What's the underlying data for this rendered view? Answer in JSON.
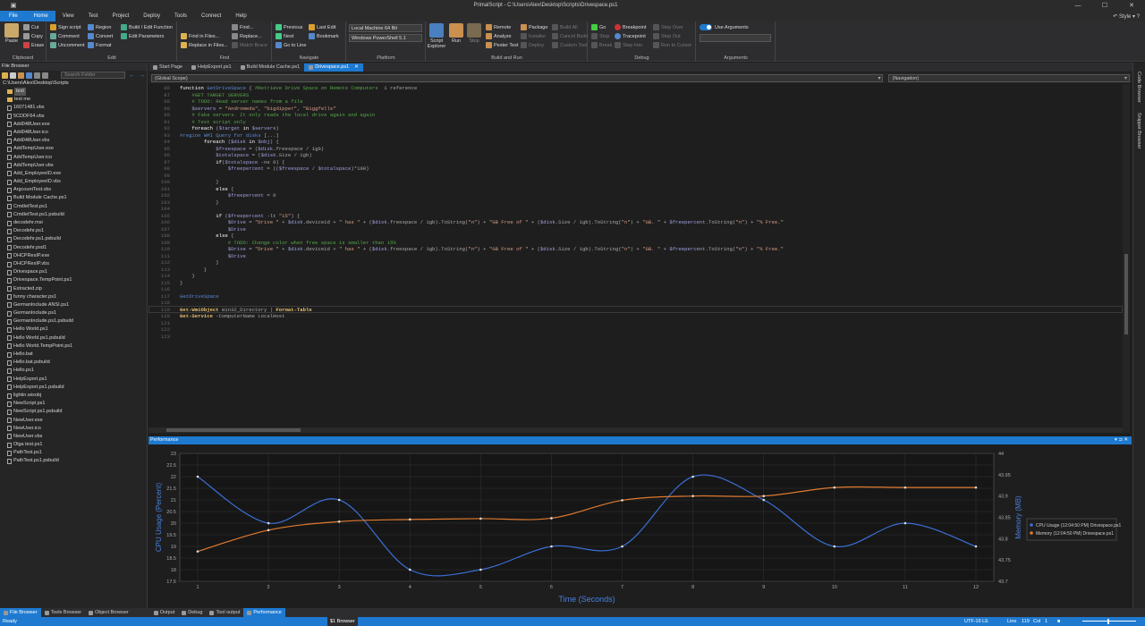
{
  "window": {
    "title": "PrimalScript - C:\\Users\\Alex\\Desktop\\Scripts\\Drivespace.ps1"
  },
  "menu": {
    "items": [
      "File",
      "Home",
      "View",
      "Test",
      "Project",
      "Deploy",
      "Tools",
      "Connect",
      "Help"
    ],
    "style": "Style"
  },
  "ribbon": {
    "clipboard": {
      "label": "Clipboard",
      "paste": "Paste",
      "cut": "Cut",
      "copy": "Copy",
      "erase": "Erase"
    },
    "edit": {
      "label": "Edit",
      "sign": "Sign script",
      "comment": "Comment",
      "uncomment": "Uncomment",
      "region": "Region",
      "convert": "Convert",
      "format": "Format",
      "build": "Build / Edit Function",
      "params": "Edit Parameters"
    },
    "find": {
      "label": "Find",
      "find": "Find...",
      "replace": "Replace...",
      "match": "Match Brace",
      "findin": "Find in Files...",
      "replacein": "Replace in Files..."
    },
    "navigate": {
      "label": "Navigate",
      "previous": "Previous",
      "next": "Next",
      "goto": "Go to Line",
      "lastedit": "Last Edit",
      "bookmark": "Bookmark"
    },
    "platform": {
      "label": "Platform",
      "machine": "Local Machine 64 Bit",
      "shell": "Windows PowerShell 5.1"
    },
    "buildrun": {
      "label": "Build and Run",
      "explorer": "Script Explorer",
      "run": "Run",
      "stop": "Stop",
      "remote": "Remote",
      "analyze": "Analyze",
      "pester": "Pester Test",
      "package": "Package",
      "installer": "Installer",
      "deploy": "Deploy",
      "buildall": "Build All",
      "cancel": "Cancel Build",
      "custom": "Custom Tool"
    },
    "debug": {
      "label": "Debug",
      "go": "Go",
      "stop": "Stop",
      "break": "Break",
      "breakpoint": "Breakpoint",
      "tracepoint": "Tracepoint",
      "stepinto": "Step Into",
      "stepover": "Step Over",
      "stepout": "Step Out",
      "runcursor": "Run to Cursor"
    },
    "arguments": {
      "label": "Arguments",
      "use": "Use Arguments"
    }
  },
  "filebrowser": {
    "title": "File Browser",
    "search": "Search Folder",
    "path": "C:\\Users\\Alex\\Desktop\\Scripts",
    "items": [
      {
        "n": "test",
        "t": "folder",
        "sel": true
      },
      {
        "n": "test me",
        "t": "folder"
      },
      {
        "n": "16071481.vbs"
      },
      {
        "n": "5CDDF64.vbs"
      },
      {
        "n": "Add048User.exe"
      },
      {
        "n": "Add048User.ico"
      },
      {
        "n": "Add048User.vbs"
      },
      {
        "n": "AddTempUser.exe"
      },
      {
        "n": "AddTempUser.ico"
      },
      {
        "n": "AddTempUser.vbs"
      },
      {
        "n": "Add_EmployeeID.exe"
      },
      {
        "n": "Add_EmployeeID.vbs"
      },
      {
        "n": "ArgcountTest.vbs"
      },
      {
        "n": "Build Module Cache.ps1"
      },
      {
        "n": "CmdletTest.ps1"
      },
      {
        "n": "CmdletTest.ps1.psbuild"
      },
      {
        "n": "decodehr.msi"
      },
      {
        "n": "Decodehr.ps1"
      },
      {
        "n": "Decodehr.ps1.psbuild"
      },
      {
        "n": "Decodehr.psd1"
      },
      {
        "n": "DHCPResIP.exe"
      },
      {
        "n": "DHCPResIP.vbs"
      },
      {
        "n": "Drivespace.ps1"
      },
      {
        "n": "Drivespace.TempPoint.ps1"
      },
      {
        "n": "Extracted.zip"
      },
      {
        "n": "funny character.ps1"
      },
      {
        "n": "GermanInclude ANSI.ps1"
      },
      {
        "n": "GermanInclude.ps1"
      },
      {
        "n": "GermanInclude.ps1.psbuild"
      },
      {
        "n": "Hello World.ps1"
      },
      {
        "n": "Hello World.ps1.psbuild"
      },
      {
        "n": "Hello World.TempPoint.ps1"
      },
      {
        "n": "Hello.bat"
      },
      {
        "n": "Hello.bat.psbuild"
      },
      {
        "n": "Hello.ps1"
      },
      {
        "n": "HelpExport.ps1"
      },
      {
        "n": "HelpExport.ps1.psbuild"
      },
      {
        "n": "lightin.wixobj"
      },
      {
        "n": "NewScript.ps1"
      },
      {
        "n": "NewScript.ps1.psbuild"
      },
      {
        "n": "NewUser.exe"
      },
      {
        "n": "NewUser.ico"
      },
      {
        "n": "NewUser.vbs"
      },
      {
        "n": "Olga test.ps1"
      },
      {
        "n": "PathTest.ps1"
      },
      {
        "n": "PathTest.ps1.psbuild"
      }
    ]
  },
  "tabs": [
    {
      "label": "Start Page"
    },
    {
      "label": "HelpExport.ps1"
    },
    {
      "label": "Build Module Cache.ps1"
    },
    {
      "label": "Drivespace.ps1",
      "active": true
    }
  ],
  "scope": {
    "left": "(Global Scope)",
    "right": "(Navigation)"
  },
  "editor": {
    "lines": [
      {
        "n": "86",
        "h": [
          [
            "kw",
            "function "
          ],
          [
            "fn",
            "GetDriveSpace"
          ],
          [
            "op",
            " { "
          ],
          [
            "cm",
            "#Retrieve Drive Space on Remote Computers"
          ],
          [
            "op",
            "  "
          ],
          [
            "op",
            "1 reference"
          ]
        ]
      },
      {
        "n": "87",
        "h": [
          [
            "cm",
            "    #GET TARGET SERVERS"
          ]
        ]
      },
      {
        "n": "88",
        "h": [
          [
            "cm",
            "    # TODO: Read server names from a file"
          ]
        ]
      },
      {
        "n": "89",
        "h": [
          [
            "vr",
            "    $servers"
          ],
          [
            "op",
            " = "
          ],
          [
            "st",
            "\"Andromeda\""
          ],
          [
            "op",
            ", "
          ],
          [
            "st",
            "\"bigdipper\""
          ],
          [
            "op",
            ", "
          ],
          [
            "st",
            "\"Biggfells\""
          ]
        ]
      },
      {
        "n": "90",
        "h": [
          [
            "cm",
            "    # Fake servers. It only reads the local drive again and again"
          ]
        ]
      },
      {
        "n": "91",
        "h": [
          [
            "cm",
            "    # Test script only"
          ]
        ]
      },
      {
        "n": "92",
        "h": [
          [
            "kw",
            "    foreach "
          ],
          [
            "op",
            "("
          ],
          [
            "vr",
            "$target"
          ],
          [
            "kw",
            " in "
          ],
          [
            "vr",
            "$servers"
          ],
          [
            "op",
            ")"
          ]
        ]
      },
      {
        "n": "93",
        "h": [
          [
            "fn",
            "#region WMI Query for disks"
          ],
          [
            "op",
            " [...]"
          ]
        ]
      },
      {
        "n": "94",
        "h": [
          [
            "kw",
            "        foreach "
          ],
          [
            "op",
            "("
          ],
          [
            "vr",
            "$disk"
          ],
          [
            "kw",
            " in "
          ],
          [
            "vr",
            "$obj"
          ],
          [
            "op",
            ") {"
          ]
        ]
      },
      {
        "n": "95",
        "h": [
          [
            "vr",
            "            $freespace"
          ],
          [
            "op",
            " = ("
          ],
          [
            "vr",
            "$disk"
          ],
          [
            "op",
            ".freespace / 1gb)"
          ]
        ]
      },
      {
        "n": "96",
        "h": [
          [
            "vr",
            "            $totalspace"
          ],
          [
            "op",
            " = ("
          ],
          [
            "vr",
            "$disk"
          ],
          [
            "op",
            ".Size / 1gb)"
          ]
        ]
      },
      {
        "n": "97",
        "h": [
          [
            "kw",
            "            if"
          ],
          [
            "op",
            "("
          ],
          [
            "vr",
            "$totalspace"
          ],
          [
            "op",
            " -ne 0) {"
          ]
        ]
      },
      {
        "n": "98",
        "h": [
          [
            "vr",
            "                $freepercent"
          ],
          [
            "op",
            " = (("
          ],
          [
            "vr",
            "$freespace"
          ],
          [
            "op",
            " / "
          ],
          [
            "vr",
            "$totalspace"
          ],
          [
            "op",
            ")*100)"
          ]
        ]
      },
      {
        "n": "99",
        "h": [
          [
            "op",
            "                "
          ]
        ]
      },
      {
        "n": "100",
        "h": [
          [
            "op",
            "            }"
          ]
        ]
      },
      {
        "n": "101",
        "h": [
          [
            "kw",
            "            else"
          ],
          [
            "op",
            " {"
          ]
        ]
      },
      {
        "n": "102",
        "h": [
          [
            "vr",
            "                $freepercent"
          ],
          [
            "op",
            " = 0"
          ]
        ]
      },
      {
        "n": "103",
        "h": [
          [
            "op",
            "            }"
          ]
        ]
      },
      {
        "n": "104",
        "h": [
          [
            "op",
            ""
          ]
        ]
      },
      {
        "n": "105",
        "h": [
          [
            "kw",
            "            if "
          ],
          [
            "op",
            "("
          ],
          [
            "vr",
            "$freepercent"
          ],
          [
            "op",
            " -lt "
          ],
          [
            "st",
            "\"15\""
          ],
          [
            "op",
            ") {"
          ]
        ]
      },
      {
        "n": "106",
        "h": [
          [
            "vr",
            "                $Drive"
          ],
          [
            "op",
            " = "
          ],
          [
            "st",
            "\"Drive \""
          ],
          [
            "op",
            " + "
          ],
          [
            "vr",
            "$disk"
          ],
          [
            "op",
            ".deviceid + "
          ],
          [
            "st",
            "\" has \""
          ],
          [
            "op",
            " + ("
          ],
          [
            "vr",
            "$disk"
          ],
          [
            "op",
            ".freespace / 1gb).ToString("
          ],
          [
            "st",
            "\"n\""
          ],
          [
            "op",
            ") + "
          ],
          [
            "st",
            "\"GB Free of \""
          ],
          [
            "op",
            " + ("
          ],
          [
            "vr",
            "$disk"
          ],
          [
            "op",
            ".Size / 1gb).ToString("
          ],
          [
            "st",
            "\"n\""
          ],
          [
            "op",
            ") + "
          ],
          [
            "st",
            "\"GB. \""
          ],
          [
            "op",
            " + "
          ],
          [
            "vr",
            "$freepercent"
          ],
          [
            "op",
            ".ToString("
          ],
          [
            "st",
            "\"n\""
          ],
          [
            "op",
            ") + "
          ],
          [
            "st",
            "\"% Free.\""
          ]
        ]
      },
      {
        "n": "107",
        "h": [
          [
            "vr",
            "                $Drive"
          ]
        ]
      },
      {
        "n": "108",
        "h": [
          [
            "kw",
            "            else"
          ],
          [
            "op",
            " {"
          ]
        ]
      },
      {
        "n": "109",
        "h": [
          [
            "cm",
            "                # TODO: Change color when free space is smaller than 15%"
          ]
        ]
      },
      {
        "n": "110",
        "h": [
          [
            "vr",
            "                $Drive"
          ],
          [
            "op",
            " = "
          ],
          [
            "st",
            "\"Drive \""
          ],
          [
            "op",
            " + "
          ],
          [
            "vr",
            "$disk"
          ],
          [
            "op",
            ".deviceid + "
          ],
          [
            "st",
            "\" has \""
          ],
          [
            "op",
            " + ("
          ],
          [
            "vr",
            "$disk"
          ],
          [
            "op",
            ".freespace / 1gb).ToString("
          ],
          [
            "st",
            "\"n\""
          ],
          [
            "op",
            ") + "
          ],
          [
            "st",
            "\"GB Free of \""
          ],
          [
            "op",
            " + ("
          ],
          [
            "vr",
            "$disk"
          ],
          [
            "op",
            ".Size / 1gb).ToString("
          ],
          [
            "st",
            "\"n\""
          ],
          [
            "op",
            ") + "
          ],
          [
            "st",
            "\"GB. \""
          ],
          [
            "op",
            " + "
          ],
          [
            "vr",
            "$freepercent"
          ],
          [
            "op",
            ".ToString("
          ],
          [
            "st",
            "\"n\""
          ],
          [
            "op",
            ") + "
          ],
          [
            "st",
            "\"% Free.\""
          ]
        ]
      },
      {
        "n": "111",
        "h": [
          [
            "vr",
            "                $Drive"
          ]
        ]
      },
      {
        "n": "112",
        "h": [
          [
            "op",
            "            }"
          ]
        ]
      },
      {
        "n": "113",
        "h": [
          [
            "op",
            "        }"
          ]
        ]
      },
      {
        "n": "114",
        "h": [
          [
            "op",
            "    }"
          ]
        ]
      },
      {
        "n": "115",
        "h": [
          [
            "op",
            "}"
          ]
        ]
      },
      {
        "n": "116",
        "h": [
          [
            "op",
            ""
          ]
        ]
      },
      {
        "n": "117",
        "h": [
          [
            "fn",
            "GetDriveSpace"
          ]
        ]
      },
      {
        "n": "118",
        "h": [
          [
            "op",
            ""
          ]
        ]
      },
      {
        "n": "119",
        "h": [
          [
            "cmd",
            "Get-WmiObject"
          ],
          [
            "op",
            " Win32_Directory | "
          ],
          [
            "cmd",
            "Format-Table"
          ]
        ]
      },
      {
        "n": "120",
        "h": [
          [
            "cmd",
            "Get-Service"
          ],
          [
            "op",
            " -ComputerName LocalHost"
          ]
        ]
      },
      {
        "n": "121",
        "h": [
          [
            "op",
            ""
          ]
        ]
      },
      {
        "n": "122",
        "h": [
          [
            "op",
            ""
          ]
        ]
      },
      {
        "n": "123",
        "h": [
          [
            "op",
            ""
          ]
        ]
      }
    ]
  },
  "rightpanel": {
    "a": "Code Browser",
    "b": "Snippet Browser"
  },
  "performance": {
    "title": "Performance"
  },
  "chart_data": {
    "type": "line",
    "x": [
      1,
      2,
      3,
      4,
      5,
      6,
      7,
      8,
      9,
      10,
      11,
      12
    ],
    "xlabel": "Time (Seconds)",
    "ylabel": "CPU Usage (Percent)",
    "y2label": "Memory (MB)",
    "ylim": [
      17.5,
      23
    ],
    "y2lim": [
      43.7,
      44
    ],
    "yticks": [
      "23",
      "22.5",
      "22",
      "21.5",
      "21",
      "20.5",
      "20",
      "19.5",
      "19",
      "18.5",
      "18",
      "17.5"
    ],
    "y2ticks": [
      "44",
      "43.95",
      "43.9",
      "43.85",
      "43.8",
      "43.75",
      "43.7"
    ],
    "series": [
      {
        "name": "CPU Usage (12:04:50 PM) Drivespace.ps1",
        "color": "#3b6fd6",
        "values": [
          22,
          20,
          21,
          18,
          18,
          19,
          19,
          22,
          21,
          19,
          20,
          19
        ]
      },
      {
        "name": "Memory (12:04:50 PM) Drivespace.ps1",
        "color": "#e07a30",
        "values": [
          43.77,
          43.82,
          43.84,
          43.845,
          43.847,
          43.848,
          43.89,
          43.9,
          43.9,
          43.92,
          43.92,
          43.92
        ]
      }
    ],
    "grid": true,
    "legend": "right"
  },
  "bottomtabs": [
    "File Browser",
    "Tools Browser",
    "Object Browser",
    "Output",
    "Debug",
    "Tool output",
    "Performance"
  ],
  "status": {
    "ready": "Ready",
    "browser": "$1 Browser",
    "encoding": "UTF-16 LE",
    "line": "Line",
    "ln": "119",
    "col": "Col",
    "cn": "1"
  }
}
